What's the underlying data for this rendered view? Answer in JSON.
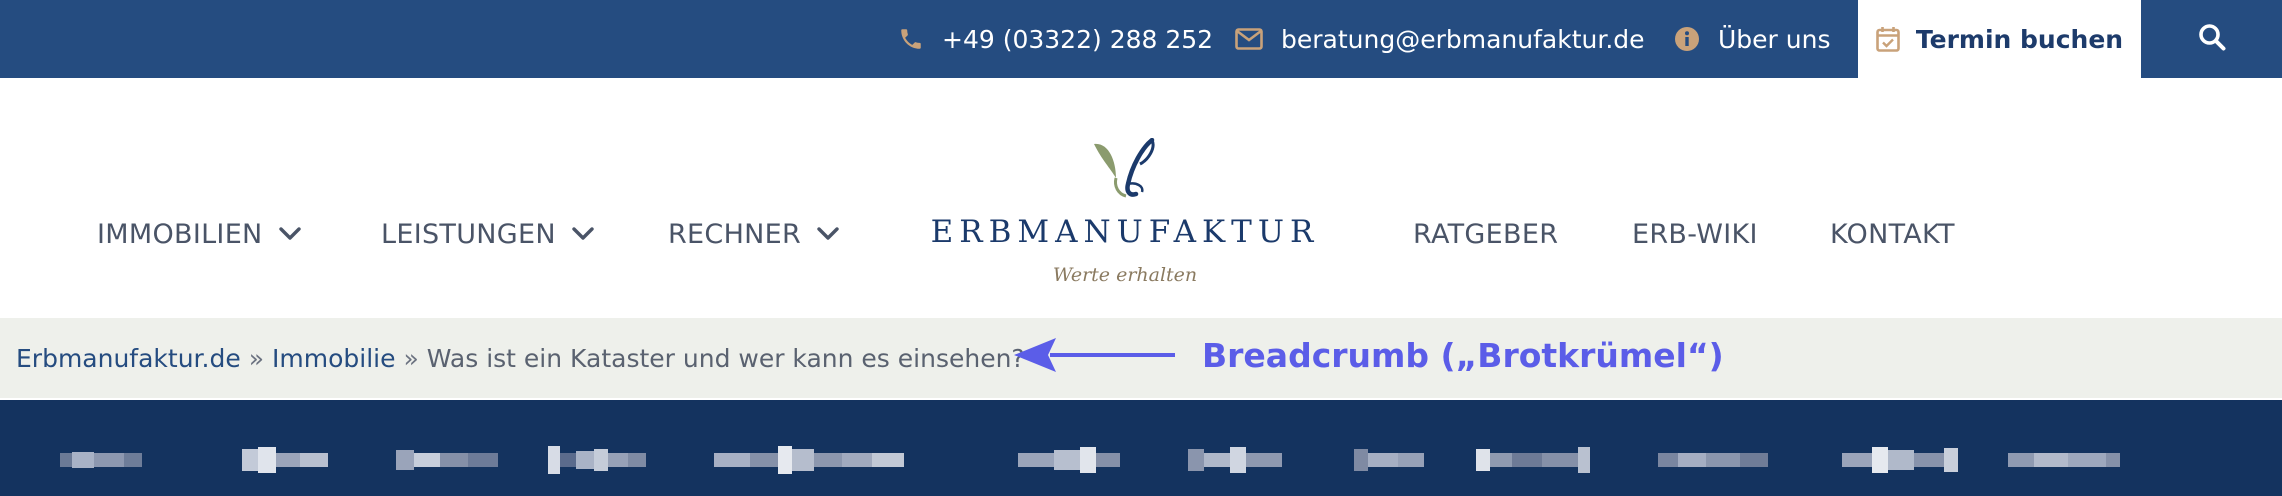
{
  "topbar": {
    "phone": "+49 (03322) 288 252",
    "email": "beratung@erbmanufaktur.de",
    "about": "Über uns",
    "termin": "Termin buchen",
    "icons": {
      "phone": "phone-icon",
      "email": "envelope-icon",
      "about": "info-circle-icon",
      "termin": "calendar-check-icon",
      "search": "search-icon"
    }
  },
  "nav": {
    "left": [
      "IMMOBILIEN",
      "LEISTUNGEN",
      "RECHNER"
    ],
    "right": [
      "RATGEBER",
      "ERB-WIKI",
      "KONTAKT"
    ]
  },
  "logo": {
    "title": "ERBMANUFAKTUR",
    "tagline": "Werte erhalten"
  },
  "breadcrumb": {
    "home": "Erbmanufaktur.de",
    "section": "Immobilie",
    "current": "Was ist ein Kataster und wer kann es einsehen?",
    "separator": "»"
  },
  "annotation": {
    "label": "Breadcrumb („Brotkrümel“)"
  },
  "colors": {
    "topbar_bg": "#254c80",
    "accent_icon": "#c9a27a",
    "breadcrumb_bg": "#eef0eb",
    "darkbar_bg": "#14335f",
    "annotation": "#5b5de8"
  }
}
